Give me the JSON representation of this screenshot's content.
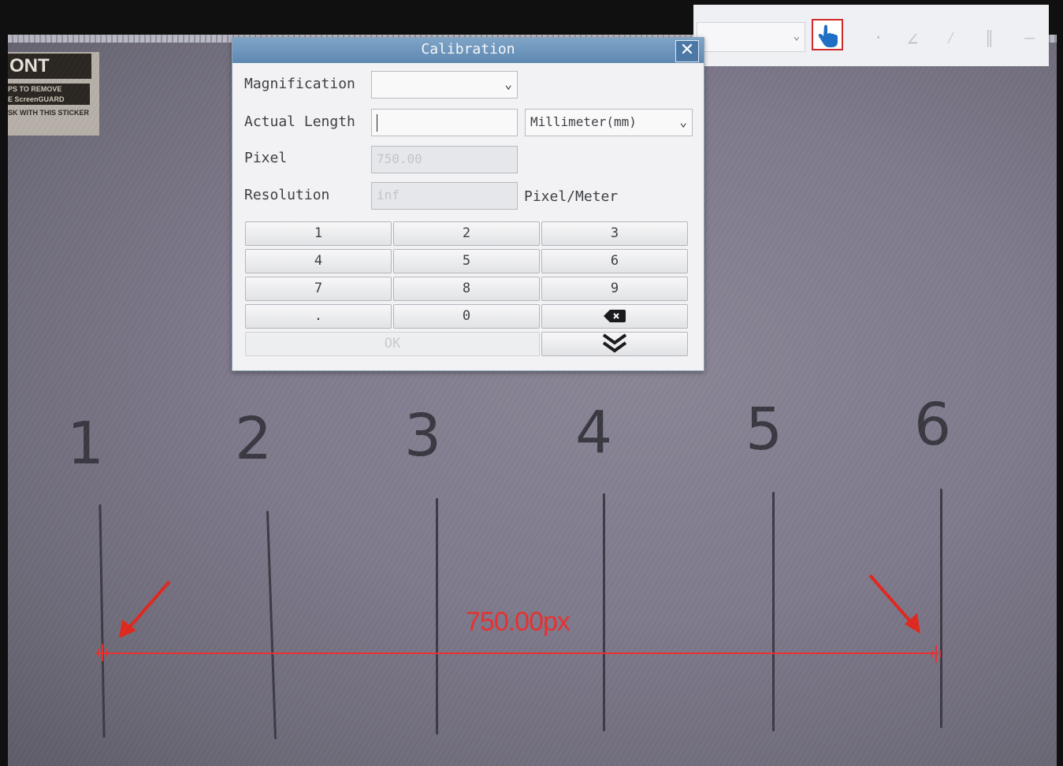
{
  "sticker": {
    "title": "ONT",
    "line1": "PS TO REMOVE",
    "line2": "E ScreenGUARD",
    "line3": "SK WITH THIS STICKER"
  },
  "dialog": {
    "title": "Calibration",
    "magnification_label": "Magnification",
    "magnification_value": "",
    "actual_length_label": "Actual Length",
    "actual_length_value": "",
    "unit_value": "Millimeter(mm)",
    "pixel_label": "Pixel",
    "pixel_value": "750.00",
    "resolution_label": "Resolution",
    "resolution_value": "inf",
    "resolution_unit": "Pixel/Meter",
    "keys": [
      "1",
      "2",
      "3",
      "4",
      "5",
      "6",
      "7",
      "8",
      "9",
      ".",
      "0"
    ],
    "ok_label": "OK"
  },
  "image": {
    "scale_numbers": [
      "1",
      "2",
      "3",
      "4",
      "5",
      "6"
    ],
    "measurement_label": "750.00px"
  },
  "colors": {
    "measure": "#e83030",
    "title_bar": "#6b93bb",
    "hand_icon": "#1f6fc4"
  }
}
